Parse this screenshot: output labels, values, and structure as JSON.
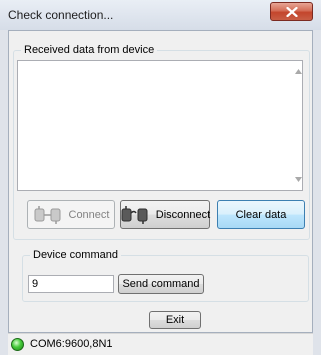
{
  "window": {
    "title": "Check connection..."
  },
  "received_group": {
    "legend": "Received data from device",
    "content": ""
  },
  "buttons": {
    "connect": "Connect",
    "disconnect": "Disconnect",
    "clear_data": "Clear data",
    "send_command": "Send command",
    "exit": "Exit"
  },
  "command_group": {
    "legend": "Device command",
    "input_value": "9"
  },
  "status": {
    "text": "COM6:9600,8N1",
    "led_color": "#3cc033"
  },
  "icons": {
    "close": "close-icon",
    "connect": "plug-connect-icon",
    "disconnect": "plug-disconnect-icon",
    "status": "status-led-icon"
  }
}
